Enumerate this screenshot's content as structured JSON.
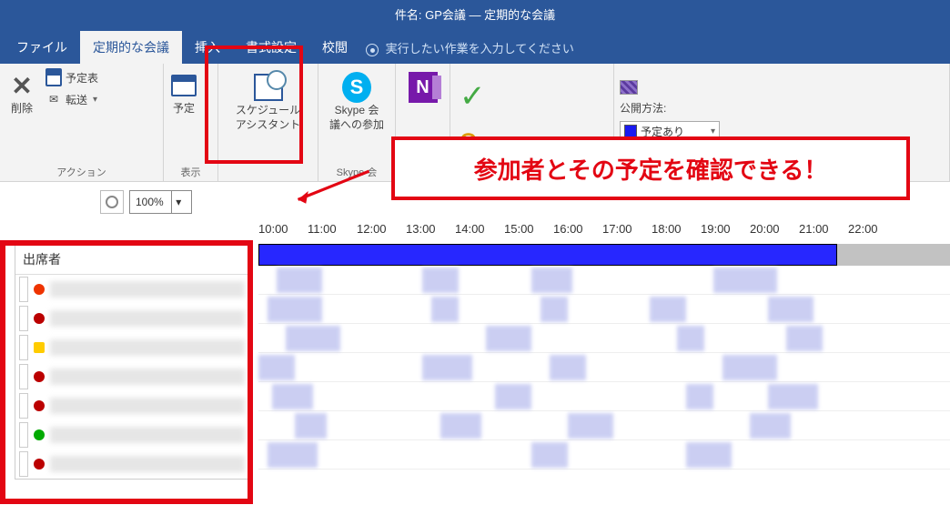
{
  "title": "件名: GP会議 — 定期的な会議",
  "tabs": {
    "file": "ファイル",
    "meeting": "定期的な会議",
    "insert": "挿入",
    "format": "書式設定",
    "review": "校閲",
    "tell_me": "実行したい作業を入力してください"
  },
  "ribbon": {
    "actions_group": "アクション",
    "delete": "削除",
    "calendar_view": "予定表",
    "forward": "転送",
    "appointment": "予定",
    "show_group": "表示",
    "schedule_assistant_l1": "スケジュール",
    "schedule_assistant_l2": "アシスタント",
    "skype_l1": "Skype 会",
    "skype_l2": "議への参加",
    "skype_group": "Skype 会",
    "onenote": "OneNote",
    "public_label": "公開方法:",
    "status_value": "予定あり"
  },
  "zoom": {
    "value": "100%"
  },
  "schedule": {
    "attendees_header": "出席者",
    "times": [
      "10:00",
      "11:00",
      "12:00",
      "13:00",
      "14:00",
      "15:00",
      "16:00",
      "17:00",
      "18:00",
      "19:00",
      "20:00",
      "21:00",
      "22:00"
    ]
  },
  "callout": "参加者とその予定を確認できる！"
}
